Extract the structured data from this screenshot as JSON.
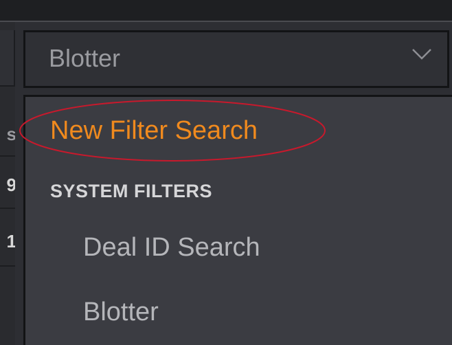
{
  "left_column": {
    "chars": [
      "s",
      "9",
      "1"
    ]
  },
  "select": {
    "value": "Blotter"
  },
  "dropdown": {
    "new_filter_label": "New Filter Search",
    "section_header": "SYSTEM FILTERS",
    "items": [
      {
        "label": "Deal ID Search"
      },
      {
        "label": "Blotter"
      }
    ]
  },
  "colors": {
    "accent": "#f08a1e",
    "highlight_ring": "#c8192c"
  }
}
